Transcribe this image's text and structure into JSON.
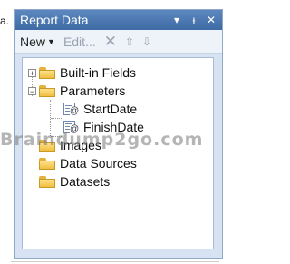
{
  "page_corner_text": "a.",
  "panel": {
    "title": "Report Data",
    "controls": {
      "dropdown": "▾",
      "pin": "ᵼ",
      "close": "✕"
    }
  },
  "toolbar": {
    "new_label": "New",
    "edit_label": "Edit...",
    "delete_icon": "✕",
    "up_icon": "⇧",
    "down_icon": "⇩"
  },
  "tree": {
    "items": [
      {
        "label": "Built-in Fields",
        "expander": "+"
      },
      {
        "label": "Parameters",
        "expander": "−"
      },
      {
        "label": "StartDate"
      },
      {
        "label": "FinishDate"
      },
      {
        "label": "Images"
      },
      {
        "label": "Data Sources"
      },
      {
        "label": "Datasets"
      }
    ]
  },
  "watermark": "Braindump2go.com",
  "colors": {
    "titlebar": "#4a78b3",
    "panel_background": "#d7e3f2",
    "folder": "#efbf42"
  }
}
